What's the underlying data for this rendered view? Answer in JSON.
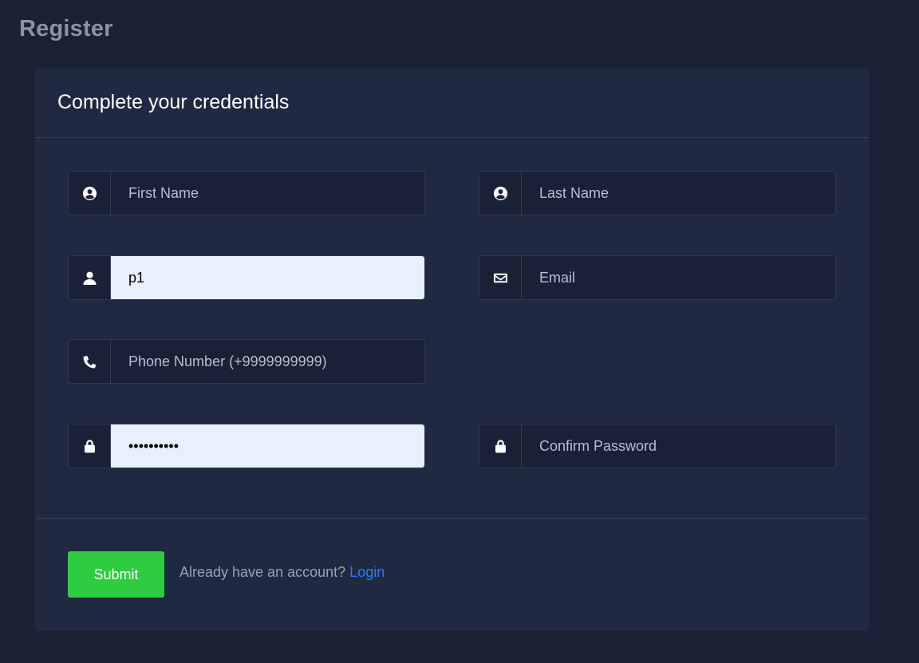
{
  "page": {
    "title": "Register"
  },
  "card": {
    "title": "Complete your credentials"
  },
  "form": {
    "first_name": {
      "placeholder": "First Name",
      "value": "",
      "icon": "user-circle-icon"
    },
    "last_name": {
      "placeholder": "Last Name",
      "value": "",
      "icon": "user-circle-icon"
    },
    "username": {
      "placeholder": "",
      "value": "p1",
      "icon": "user-icon"
    },
    "email": {
      "placeholder": "Email",
      "value": "",
      "icon": "envelope-icon"
    },
    "phone": {
      "placeholder": "Phone Number (+9999999999)",
      "value": "",
      "icon": "phone-icon"
    },
    "password": {
      "placeholder": "",
      "value": "••••••••••",
      "icon": "lock-icon"
    },
    "confirm_password": {
      "placeholder": "Confirm Password",
      "value": "",
      "icon": "lock-icon"
    }
  },
  "footer": {
    "submit_label": "Submit",
    "prompt_text": "Already have an account?",
    "login_label": "Login"
  },
  "colors": {
    "background": "#1b2135",
    "card": "#202942",
    "submit": "#2ecc40",
    "link": "#2f7cf6",
    "autofill": "#e8f0fe"
  }
}
